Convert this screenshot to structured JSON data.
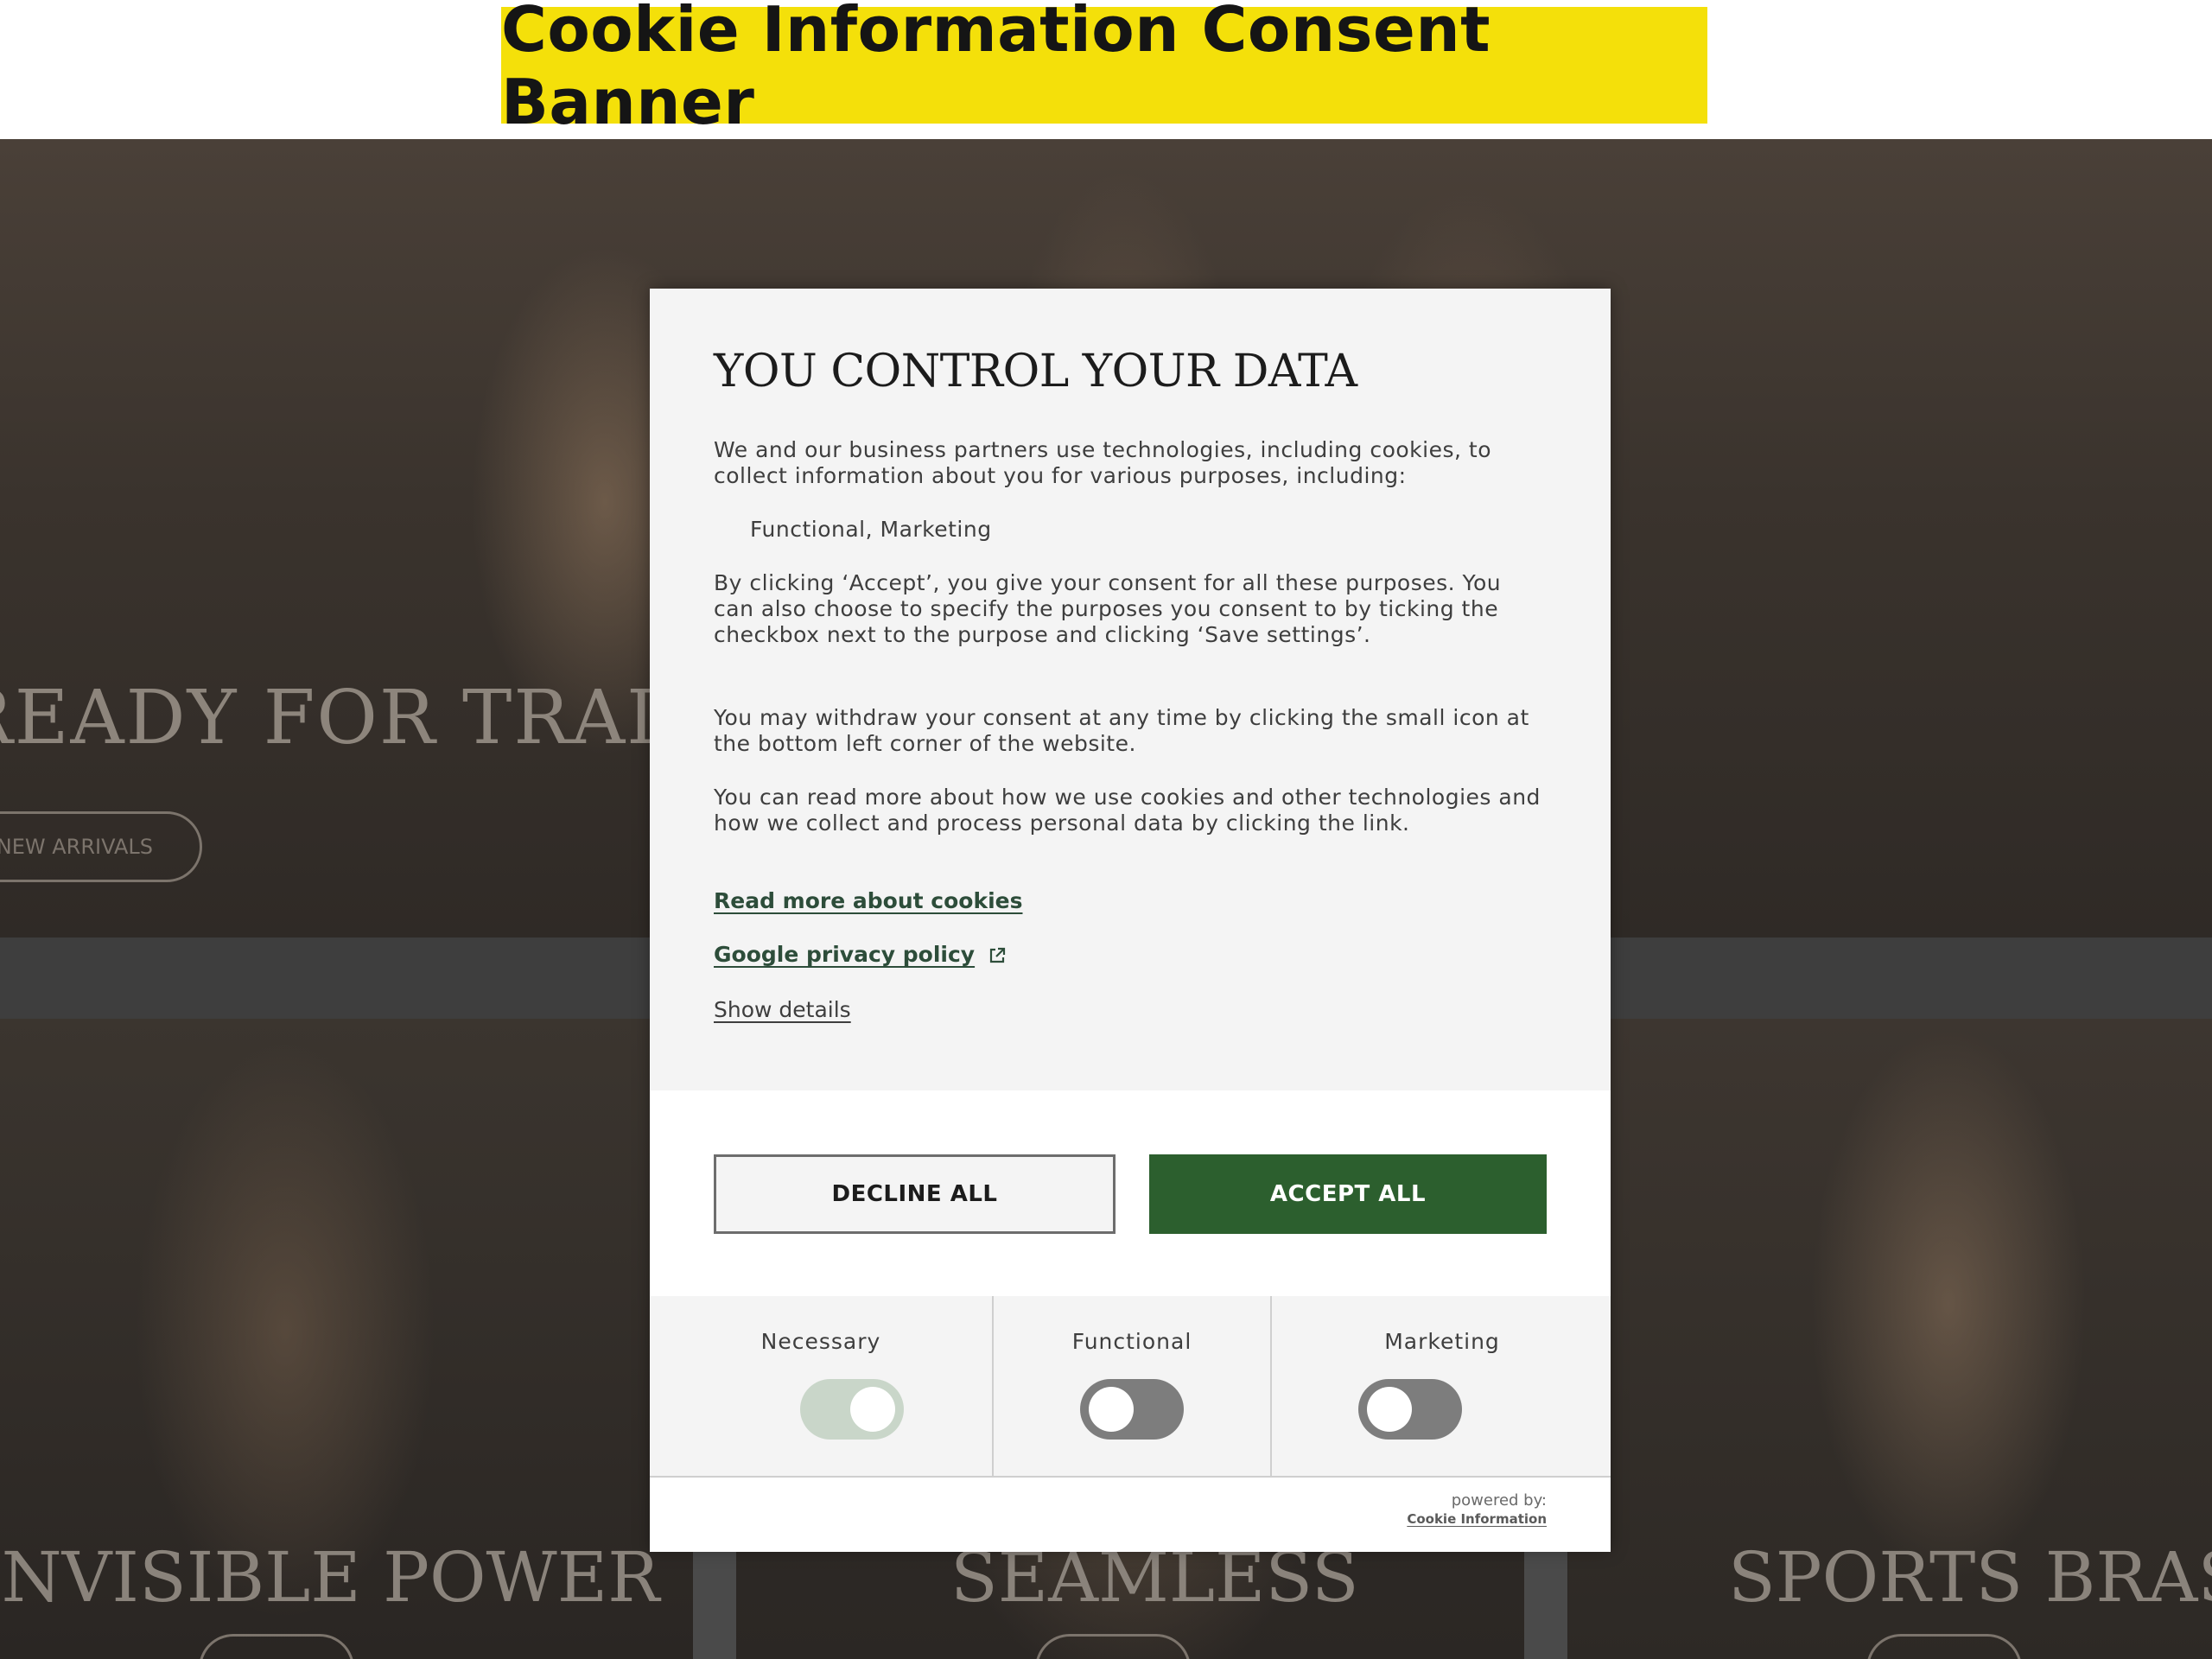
{
  "caption": "Cookie Information Consent Banner",
  "site": {
    "hero_title": "READY FOR TRAINING",
    "hero_button": "NEW ARRIVALS",
    "tiles": [
      "INVISIBLE POWER",
      "SEAMLESS",
      "SPORTS BRAS"
    ]
  },
  "modal": {
    "title": "YOU CONTROL YOUR DATA",
    "intro": "We and our business partners use technologies, including cookies, to collect information about you for various purposes, including:",
    "purposes": "Functional,  Marketing",
    "consent_text": "By clicking ‘Accept’, you give your consent for all these purposes. You can also choose to specify the purposes you consent to by ticking the checkbox next to the purpose and clicking ‘Save settings’.",
    "withdraw_text": "You may withdraw your consent at any time by clicking the small icon at the bottom left corner of the website.",
    "read_more_text": "You can read more about how we use cookies and other technologies and how we collect and process personal data by clicking the link.",
    "links": {
      "read_more": "Read more about cookies",
      "google_privacy": "Google privacy policy",
      "show_details": "Show details"
    },
    "buttons": {
      "decline": "DECLINE ALL",
      "accept": "ACCEPT ALL"
    },
    "toggles": [
      {
        "label": "Necessary",
        "state": "on-disabled"
      },
      {
        "label": "Functional",
        "state": "off"
      },
      {
        "label": "Marketing",
        "state": "off"
      }
    ],
    "footer": {
      "powered_by": "powered by:",
      "brand": "Cookie Information"
    }
  },
  "colors": {
    "caption_bg": "#f4e00a",
    "accept_bg": "#2c5f2e",
    "toggle_on_disabled": "#c9d6c9",
    "toggle_off": "#7d7d7d"
  },
  "icons": [
    "external-link-icon"
  ]
}
